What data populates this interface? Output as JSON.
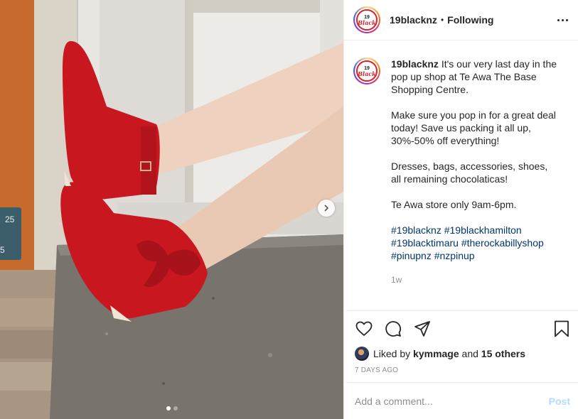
{
  "post": {
    "username": "19blacknz",
    "separator": "•",
    "follow_status": "Following",
    "logo_number": "19",
    "logo_word": "Black"
  },
  "caption": {
    "username": "19blacknz",
    "line1": "It's our very last day in the pop up shop at Te Awa The Base Shopping Centre.",
    "para2": "Make sure you pop in for a great deal today! Save us packing it all up, 30%-50% off everything!",
    "para3": "Dresses, bags, accessories, shoes, all remaining chocolaticas!",
    "para4": "Te Awa store only 9am-6pm.",
    "hashtags": [
      "#19blacknz",
      "#19blackhamilton",
      "#19blacktimaru",
      "#therockabillyshop",
      "#pinupnz",
      "#nzpinup"
    ],
    "time_ago": "1w"
  },
  "likes": {
    "prefix": "Liked by",
    "user": "kymmage",
    "and": "and",
    "others": "15 others"
  },
  "date": "7 DAYS AGO",
  "comment": {
    "placeholder": "Add a comment...",
    "post_label": "Post"
  },
  "media": {
    "door_number": "25",
    "door_number_2": "5",
    "carousel_count": 2,
    "carousel_active": 0
  },
  "icons": [
    "more-options-icon",
    "heart-icon",
    "comment-icon",
    "share-icon",
    "bookmark-icon",
    "chevron-right-icon"
  ],
  "colors": {
    "boot_red": "#c8171f",
    "link_blue": "#00376b",
    "post_disabled_blue": "#b3dbff",
    "muted_text": "#8e8e8e"
  }
}
